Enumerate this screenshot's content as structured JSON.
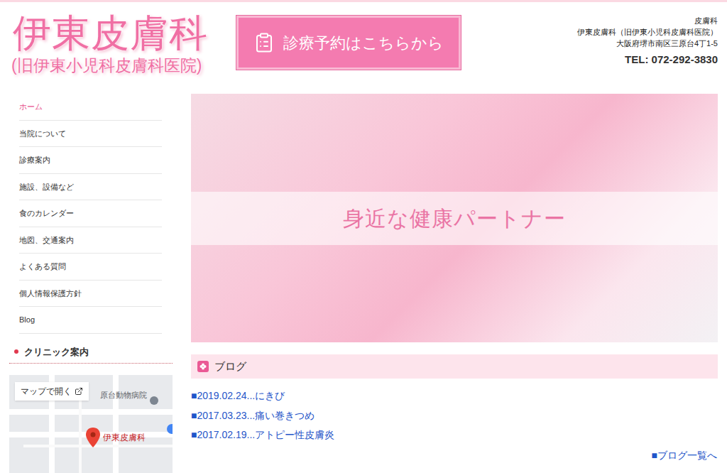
{
  "header": {
    "logo_title": "伊東皮膚科",
    "logo_subtitle": "(旧伊東小児科皮膚科医院)",
    "reserve_button": "診療予約はこちらから",
    "info_lines": [
      "皮膚科",
      "伊東皮膚科（旧伊東小児科皮膚科医院）",
      "大阪府堺市南区三原台4丁1-5"
    ],
    "tel": "TEL: 072-292-3830"
  },
  "nav": [
    {
      "label": "ホーム",
      "selected": true
    },
    {
      "label": "当院について",
      "selected": false
    },
    {
      "label": "診療案内",
      "selected": false
    },
    {
      "label": "施設、設備など",
      "selected": false
    },
    {
      "label": "食のカレンダー",
      "selected": false
    },
    {
      "label": "地図、交通案内",
      "selected": false
    },
    {
      "label": "よくある質問",
      "selected": false
    },
    {
      "label": "個人情報保護方針",
      "selected": false
    },
    {
      "label": "Blog",
      "selected": false
    }
  ],
  "clinic": {
    "heading": "クリニック案内",
    "map_open": "マップで開く",
    "map_poi": "原台動物病院",
    "map_pin": "伊東皮膚科"
  },
  "hero": {
    "caption": "身近な健康パートナー"
  },
  "blog": {
    "heading": "ブログ",
    "entries": [
      "■2019.02.24...にきび",
      "■2017.03.23...痛い巻きつめ",
      "■2017.02.19...アトピー性皮膚炎"
    ],
    "more": "■ブログ一覧へ"
  }
}
